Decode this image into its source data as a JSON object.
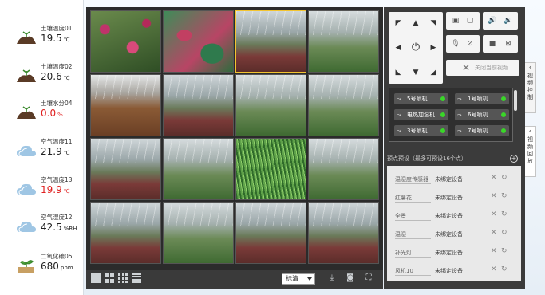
{
  "sensors": [
    {
      "label": "土壤温度01",
      "value": "19.5",
      "unit": "℃",
      "alert": false,
      "icon": "soil-icon"
    },
    {
      "label": "土壤温度02",
      "value": "20.6",
      "unit": "℃",
      "alert": false,
      "icon": "soil-icon"
    },
    {
      "label": "土壤水分04",
      "value": "0.0",
      "unit": "%",
      "alert": true,
      "icon": "soil-icon"
    },
    {
      "label": "空气温度11",
      "value": "21.9",
      "unit": "℃",
      "alert": false,
      "icon": "cloud-icon"
    },
    {
      "label": "空气温度13",
      "value": "19.9",
      "unit": "℃",
      "alert": true,
      "icon": "cloud-icon"
    },
    {
      "label": "空气湿度12",
      "value": "42.5",
      "unit": "%RH",
      "alert": false,
      "icon": "cloud-icon"
    },
    {
      "label": "二氧化碳05",
      "value": "680",
      "unit": "ppm",
      "alert": false,
      "icon": "co2-plant-icon"
    }
  ],
  "video": {
    "selected_tile": 2,
    "quality": "标清",
    "tiles": [
      {
        "scene": "flowers"
      },
      {
        "scene": "leaves"
      },
      {
        "scene": "greenhouse-red"
      },
      {
        "scene": "greenhouse-green"
      },
      {
        "scene": "soil"
      },
      {
        "scene": "greenhouse-red"
      },
      {
        "scene": "greenhouse-green"
      },
      {
        "scene": "greenhouse-green"
      },
      {
        "scene": "greenhouse-red"
      },
      {
        "scene": "greenhouse-green"
      },
      {
        "scene": "plants"
      },
      {
        "scene": "greenhouse-green"
      },
      {
        "scene": "greenhouse-red"
      },
      {
        "scene": "greenhouse-green"
      },
      {
        "scene": "greenhouse-red"
      },
      {
        "scene": "greenhouse-red"
      }
    ]
  },
  "controls": {
    "close_all_label": "关闭当前视频",
    "valves": [
      {
        "label": "5号喷机",
        "on": true
      },
      {
        "label": "1号喷机",
        "on": true
      },
      {
        "label": "电热加湿机",
        "on": true
      },
      {
        "label": "6号喷机",
        "on": true
      },
      {
        "label": "3号喷机",
        "on": true
      },
      {
        "label": "7号喷机",
        "on": true
      }
    ],
    "presets_header": "预点预设（最多可预设16个点）",
    "presets": [
      {
        "name": "温湿度传感器",
        "status": "未绑定设备"
      },
      {
        "name": "红薯花",
        "status": "未绑定设备"
      },
      {
        "name": "全景",
        "status": "未绑定设备"
      },
      {
        "name": "温湿",
        "status": "未绑定设备"
      },
      {
        "name": "补光灯",
        "status": "未绑定设备"
      },
      {
        "name": "风机10",
        "status": "未绑定设备"
      }
    ]
  },
  "side_tabs": [
    {
      "label": "视频控制",
      "active": true
    },
    {
      "label": "视频回放",
      "active": false
    }
  ],
  "colors": {
    "alert": "#e02020",
    "valve_on": "#3ad629",
    "selected_border": "#f3c430"
  }
}
